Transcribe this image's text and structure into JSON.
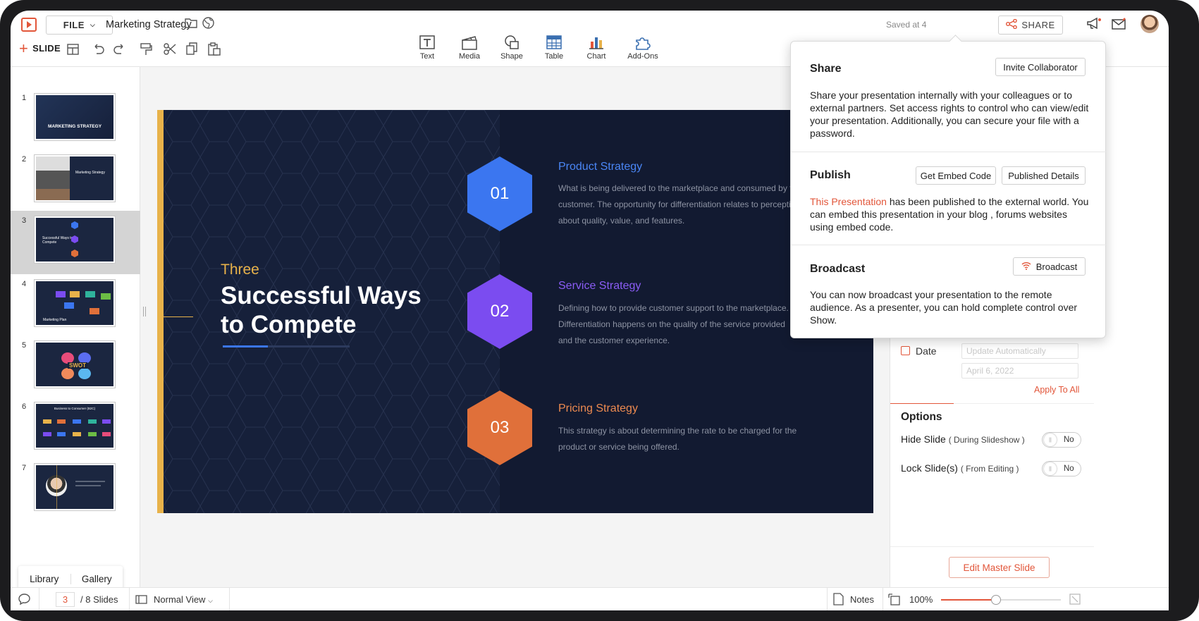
{
  "header": {
    "file_label": "FILE",
    "doc_title": "Marketing Strategy",
    "saved_status": "Saved at 4",
    "share_label": "SHARE"
  },
  "toolbar": {
    "slide_label": "SLIDE",
    "tools": [
      {
        "label": "Text",
        "icon": "text-box-icon"
      },
      {
        "label": "Media",
        "icon": "media-clapper-icon"
      },
      {
        "label": "Shape",
        "icon": "shape-icon"
      },
      {
        "label": "Table",
        "icon": "table-icon"
      },
      {
        "label": "Chart",
        "icon": "bar-chart-icon"
      },
      {
        "label": "Add-Ons",
        "icon": "puzzle-icon"
      }
    ]
  },
  "thumbnails": {
    "numbers": [
      "1",
      "2",
      "3",
      "4",
      "5",
      "6",
      "7"
    ],
    "selected": "3",
    "t1_title": "MARKETING STRATEGY",
    "t2_title": "Marketing Strategy",
    "t3_title": "Successful Ways to Compete",
    "t4_title": "Marketing Plan",
    "t5_title": "SWOT",
    "t6_title": "Business to Consumer (B2C)"
  },
  "library_tabs": {
    "library": "Library",
    "gallery": "Gallery"
  },
  "slide": {
    "kicker": "Three",
    "title": "Successful Ways to Compete",
    "items": [
      {
        "num": "01",
        "heading": "Product Strategy",
        "text": "What is being  delivered  to the marketplace  and consumed  by the customer.  The opportunity  for  differentiation  relates  to perceptions  about  quality,  value,  and features.",
        "color": "#3b76f0"
      },
      {
        "num": "02",
        "heading": "Service Strategy",
        "text": "Defining  how to provide  customer  support  to the marketplace. Differentiation  happens  on the quality  of the service  provided and the customer  experience.",
        "color": "#7b4cf0"
      },
      {
        "num": "03",
        "heading": "Pricing Strategy",
        "text": "This  strategy  is about  determining  the rate to be charged  for the product  or service  being  offered.",
        "color": "#e0703a"
      }
    ]
  },
  "props": {
    "date_label": "Date",
    "date_mode": "Update Automatically",
    "date_value": "April 6, 2022",
    "apply_all": "Apply To All",
    "options_heading": "Options",
    "hide_slide": "Hide Slide",
    "hide_slide_note": "( During Slideshow )",
    "hide_toggle": "No",
    "lock_slide": "Lock Slide(s)",
    "lock_slide_note": "( From Editing )",
    "lock_toggle": "No",
    "edit_master": "Edit Master Slide"
  },
  "status": {
    "current_slide": "3",
    "total": "/ 8 Slides",
    "view": "Normal View",
    "notes": "Notes",
    "zoom": "100%",
    "zoom_fraction": 0.46
  },
  "share_popover": {
    "share": {
      "heading": "Share",
      "button": "Invite Collaborator",
      "text": "Share your presentation internally with your colleagues or to external partners. Set access rights to control who can view/edit your presentation. Additionally, you can secure your file with a password."
    },
    "publish": {
      "heading": "Publish",
      "embed_button": "Get Embed Code",
      "details_button": "Published Details",
      "link_text": "This Presentation",
      "text_after_link": " has been published to the external world. You can embed this presentation in your blog , forums websites using embed code."
    },
    "broadcast": {
      "heading": "Broadcast",
      "button": "Broadcast",
      "text": "You can now broadcast your presentation to the remote audience. As a presenter, you can hold complete control over Show."
    }
  },
  "colors": {
    "accent": "#e2563a",
    "slide_bg": "#16203a",
    "gold": "#e8b24a"
  }
}
